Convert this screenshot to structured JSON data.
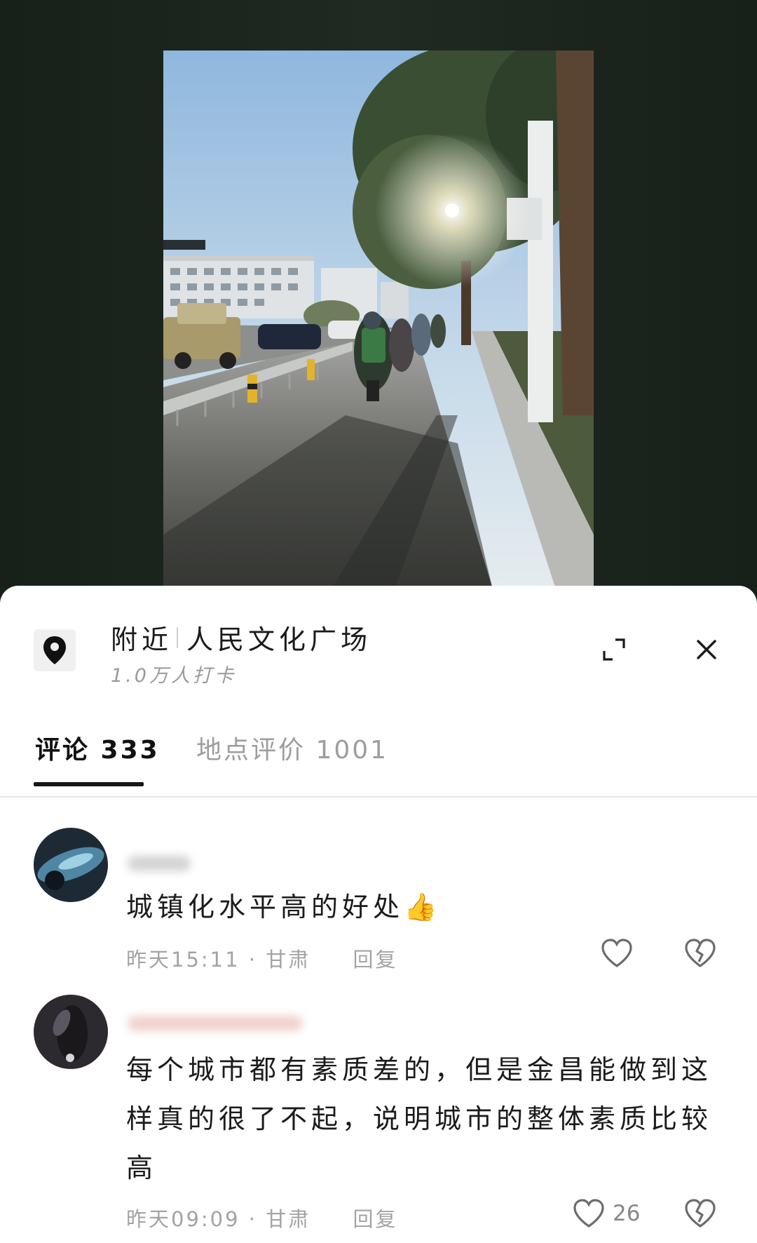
{
  "location": {
    "prefix": "附近",
    "name": "人民文化广场",
    "checkins": "1.0万人打卡"
  },
  "tabs": {
    "comments_label": "评论 333",
    "reviews_label": "地点评价 1001"
  },
  "comments": [
    {
      "text": "城镇化水平高的好处",
      "emoji": "👍",
      "time": "昨天15:11",
      "region": "甘肃",
      "reply_label": "回复",
      "likes": ""
    },
    {
      "text": "每个城市都有素质差的，但是金昌能做到这样真的很了不起，说明城市的整体素质比较高",
      "time": "昨天09:09",
      "region": "甘肃",
      "reply_label": "回复",
      "likes": "26"
    }
  ],
  "meta_sep": "·",
  "icons": {
    "location": "location-pin-icon",
    "expand": "expand-icon",
    "close": "close-icon",
    "like": "heart-icon",
    "dislike": "broken-heart-icon"
  }
}
